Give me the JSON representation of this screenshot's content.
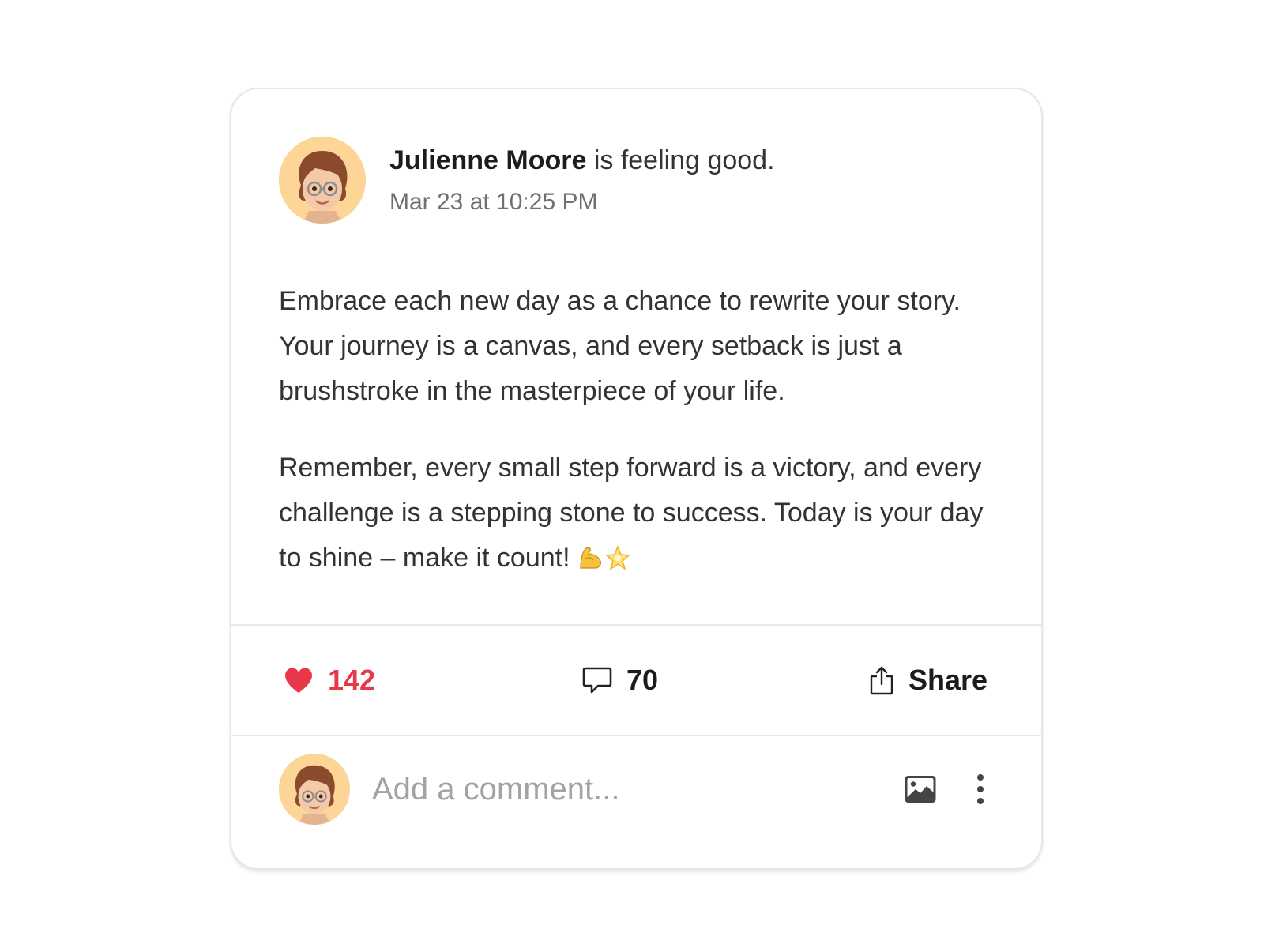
{
  "post": {
    "author_name": "Julienne Moore",
    "feeling_text": " is feeling good.",
    "timestamp": "Mar 23 at 10:25 PM",
    "paragraphs": [
      "Embrace each new day as a chance to rewrite your story. Your journey is a canvas, and every setback is just a brushstroke in the masterpiece of your life.",
      "Remember, every small step forward is a victory, and every challenge is a stepping stone to success. Today is your day to shine – make it count!"
    ],
    "paragraph_emojis": [
      "flexed-biceps-emoji",
      "glowing-star-emoji"
    ]
  },
  "actions": {
    "likes": "142",
    "comments": "70",
    "share_label": "Share"
  },
  "comment_box": {
    "placeholder": "Add a comment..."
  },
  "icons": {
    "like": "heart-icon",
    "comment": "speech-bubble-icon",
    "share": "share-upload-icon",
    "attach_image": "image-icon",
    "more": "more-vertical-icon"
  },
  "colors": {
    "like_accent": "#e8394a",
    "avatar_bg": "#fcd597",
    "border": "#e6e6e6",
    "text": "#333333",
    "muted": "#707070",
    "placeholder": "#a3a3a3"
  }
}
